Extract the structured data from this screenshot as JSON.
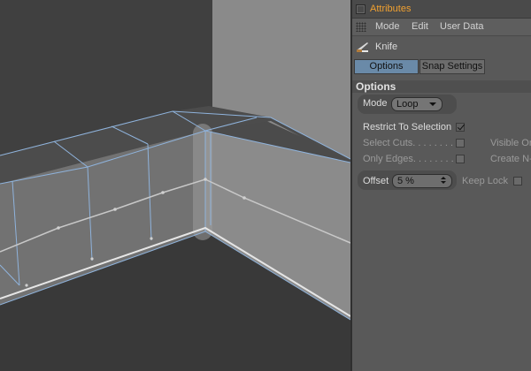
{
  "panel": {
    "title": "Attributes",
    "menu": [
      "Mode",
      "Edit",
      "User Data"
    ],
    "tool_name": "Knife",
    "tabs": [
      "Options",
      "Snap Settings"
    ],
    "section": "Options"
  },
  "options": {
    "mode_label": "Mode",
    "mode_value": "Loop",
    "restrict_label": "Restrict To Selection",
    "restrict_checked": true,
    "select_cuts_label": "Select Cuts. . . . . . . . .",
    "only_edges_label": "Only Edges. . . . . . . . .",
    "visible_only_label": "Visible Onl",
    "create_ngons_label": "Create N-g",
    "offset_label": "Offset",
    "offset_value": "5 %",
    "keep_lock_label": "Keep Lock"
  },
  "colors": {
    "title_accent": "#f0a030",
    "active_tab": "#6a8aa8",
    "edge_highlight": "#8fb3dc"
  },
  "icons": [
    "checkbox-icon",
    "grip-icon",
    "knife-icon",
    "dropdown-arrow-icon",
    "spinner-icon"
  ]
}
